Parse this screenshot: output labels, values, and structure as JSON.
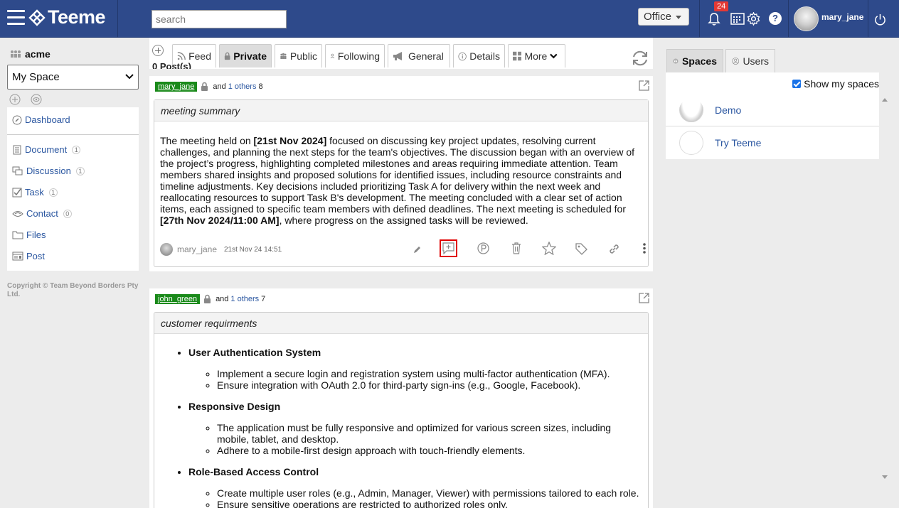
{
  "header": {
    "app_name": "Teeme",
    "search_placeholder": "search",
    "office_label": "Office",
    "notification_count": "24",
    "username": "mary_jane"
  },
  "sidebar": {
    "org_name": "acme",
    "space_selected": "My Space",
    "items": [
      {
        "label": "Dashboard",
        "icon": "dashboard-icon",
        "count": ""
      },
      {
        "label": "Document",
        "icon": "document-icon",
        "count": "1"
      },
      {
        "label": "Discussion",
        "icon": "discussion-icon",
        "count": "1"
      },
      {
        "label": "Task",
        "icon": "task-icon",
        "count": "1"
      },
      {
        "label": "Contact",
        "icon": "contact-icon",
        "count": "0"
      },
      {
        "label": "Files",
        "icon": "folder-icon",
        "count": ""
      },
      {
        "label": "Post",
        "icon": "post-icon",
        "count": ""
      }
    ],
    "copyright": "Copyright © Team Beyond Borders Pty Ltd."
  },
  "tabs": [
    {
      "label": "Feed"
    },
    {
      "label": "Private"
    },
    {
      "label": "Public"
    },
    {
      "label": "Following"
    },
    {
      "label": "General"
    },
    {
      "label": "Details"
    },
    {
      "label": "More"
    }
  ],
  "posts_count": "0 Post(s)",
  "posts": [
    {
      "author": "mary_jane",
      "and_text": "and",
      "others": "1 others",
      "others_count": "8",
      "title": "meeting summary",
      "body_parts": {
        "p1": "The meeting held on ",
        "b1": "[21st Nov 2024]",
        "p2": " focused on discussing key project updates, resolving current challenges, and planning the next steps for the team's objectives. The discussion began with an overview of the project’s progress, highlighting completed milestones and areas requiring immediate attention. Team members shared insights and proposed solutions for identified issues, including resource constraints and timeline adjustments. Key decisions included prioritizing Task A for delivery within the next week and reallocating resources to support Task B's development. The meeting concluded with a clear set of action items, each assigned to specific team members with defined deadlines. The next meeting is scheduled for ",
        "b2": "[27th Nov 2024/11:00 AM]",
        "p3": ", where progress on the assigned tasks will be reviewed."
      },
      "footer_user": "mary_jane",
      "footer_date": "21st Nov 24 14:51"
    },
    {
      "author": "john_green",
      "and_text": "and",
      "others": "1 others",
      "others_count": "7",
      "title": "customer requirments",
      "sections": [
        {
          "heading": "User Authentication System",
          "items": [
            "Implement a secure login and registration system using multi-factor authentication (MFA).",
            "Ensure integration with OAuth 2.0 for third-party sign-ins (e.g., Google, Facebook)."
          ]
        },
        {
          "heading": "Responsive Design",
          "items": [
            "The application must be fully responsive and optimized for various screen sizes, including mobile, tablet, and desktop.",
            "Adhere to a mobile-first design approach with touch-friendly elements."
          ]
        },
        {
          "heading": "Role-Based Access Control",
          "items": [
            "Create multiple user roles (e.g., Admin, Manager, Viewer) with permissions tailored to each role.",
            "Ensure sensitive operations are restricted to authorized roles only."
          ]
        }
      ]
    }
  ],
  "right_panel": {
    "tabs": [
      {
        "label": "Spaces"
      },
      {
        "label": "Users"
      }
    ],
    "show_my_spaces": "Show my spaces",
    "spaces": [
      {
        "name": "Demo"
      },
      {
        "name": "Try Teeme"
      }
    ]
  },
  "colors": {
    "header_bg": "#2e4a8b",
    "user_tag": "#1a8a1a",
    "link": "#2a56a0",
    "badge": "#e53935"
  }
}
